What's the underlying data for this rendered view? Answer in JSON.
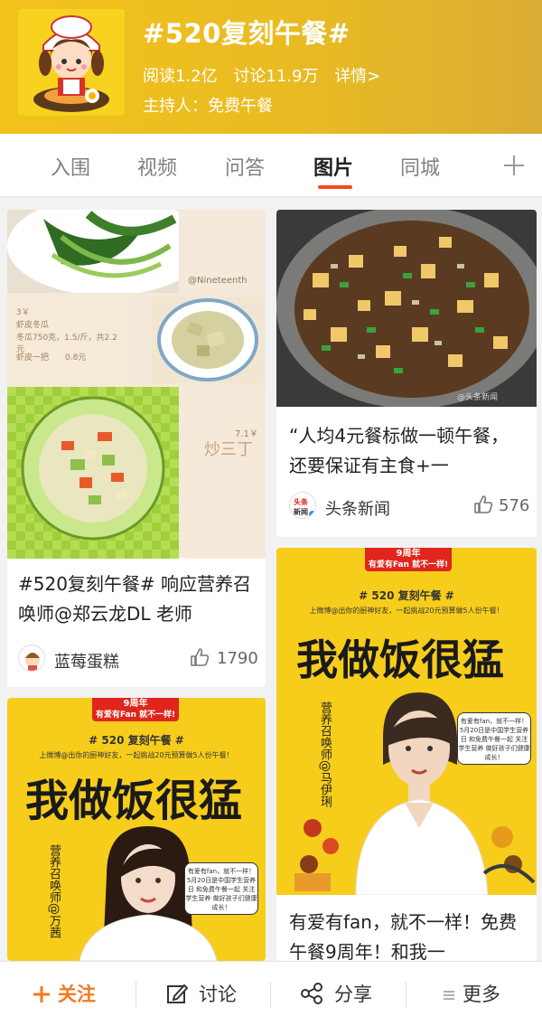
{
  "header": {
    "title": "#520复刻午餐#",
    "read": "阅读1.2亿",
    "discuss": "讨论11.9万",
    "detail": "详情>",
    "host": "主持人：免费午餐",
    "brand_color": "#f3c21c"
  },
  "tabs": [
    {
      "label": "入围"
    },
    {
      "label": "视频"
    },
    {
      "label": "问答"
    },
    {
      "label": "图片",
      "active": true
    },
    {
      "label": "同城"
    }
  ],
  "cards": {
    "left1": {
      "collage_texts": [
        "@Nineteenth",
        "3￥",
        "虾皮冬瓜",
        "冬瓜750克，1.5/斤，共2.2元",
        "虾皮一把　　0.8元",
        "7.1￥",
        "炒三丁"
      ],
      "title": "#520复刻午餐# 响应营养召唤师@郑云龙DL 老师",
      "author": "蓝莓蛋糕",
      "likes": "1790"
    },
    "right1": {
      "watermark": "@头条新闻",
      "title": "“人均4元餐标做一顿午餐，还要保证有主食+一",
      "author": "头条新闻",
      "author_badge": "头条新闻",
      "likes": "576"
    },
    "right2": {
      "badge_top": "9周年",
      "badge_sub": "有爱有Fan 就不一样!",
      "tag": "# 520 复刻午餐 #",
      "sub": "上微博@出你的厨神好友，一起挑战20元预算做5人份午餐！",
      "big": "我做饭很猛",
      "vertical": "营养召唤师@马伊琍",
      "bubble": "有爱有fan，就不一样！ 5月20日是中国学生营养日 和免费午餐一起 关注学生营养 做好孩子们健康成长！",
      "title": "有爱有fan，就不一样！免费午餐9周年！和我一"
    },
    "left2": {
      "badge_top": "9周年",
      "badge_sub": "有爱有Fan 就不一样!",
      "tag": "# 520 复刻午餐 #",
      "sub": "上微博@出你的厨神好友，一起挑战20元预算做5人份午餐！",
      "big": "我做饭很猛",
      "vertical": "营养召唤师@万茜",
      "bubble": "有爱有fan，就不一样！ 5月20日是中国学生营养日 和免费午餐一起 关注学生营养 做好孩子们健康成长！"
    }
  },
  "bottombar": {
    "follow": "关注",
    "discuss": "讨论",
    "share": "分享",
    "more": "更多",
    "accent": "#f5791f"
  }
}
